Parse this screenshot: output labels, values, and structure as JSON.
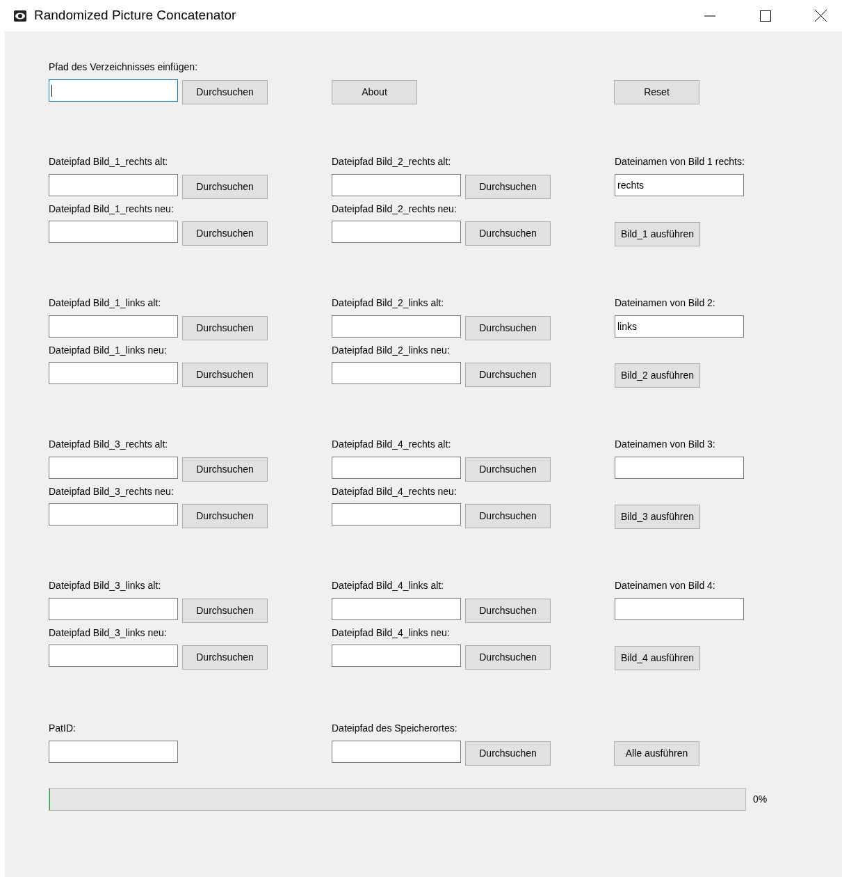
{
  "window": {
    "title": "Randomized Picture Concatenator"
  },
  "directory": {
    "label": "Pfad des Verzeichnisses einfügen:",
    "focused": true,
    "button": "Durchsuchen"
  },
  "about_button": "About",
  "reset_button": "Reset",
  "groups": [
    {
      "columns": [
        [
          {
            "label": "Dateipfad Bild_1_rechts alt:",
            "button": "Durchsuchen"
          },
          {
            "label": "Dateipfad Bild_1_rechts neu:",
            "button": "Durchsuchen"
          }
        ],
        [
          {
            "label": "Dateipfad Bild_2_rechts alt:",
            "button": "Durchsuchen"
          },
          {
            "label": "Dateipfad Bild_2_rechts neu:",
            "button": "Durchsuchen"
          }
        ]
      ],
      "name_label": "Dateinamen von Bild 1 rechts:",
      "name_value": "rechts",
      "run_button": "Bild_1 ausführen"
    },
    {
      "columns": [
        [
          {
            "label": "Dateipfad Bild_1_links alt:",
            "button": "Durchsuchen"
          },
          {
            "label": "Dateipfad Bild_1_links neu:",
            "button": "Durchsuchen"
          }
        ],
        [
          {
            "label": "Dateipfad Bild_2_links alt:",
            "button": "Durchsuchen"
          },
          {
            "label": "Dateipfad Bild_2_links neu:",
            "button": "Durchsuchen"
          }
        ]
      ],
      "name_label": "Dateinamen von Bild 2:",
      "name_value": "links",
      "run_button": "Bild_2 ausführen"
    },
    {
      "columns": [
        [
          {
            "label": "Dateipfad Bild_3_rechts alt:",
            "button": "Durchsuchen"
          },
          {
            "label": "Dateipfad Bild_3_rechts neu:",
            "button": "Durchsuchen"
          }
        ],
        [
          {
            "label": "Dateipfad Bild_4_rechts alt:",
            "button": "Durchsuchen"
          },
          {
            "label": "Dateipfad Bild_4_rechts neu:",
            "button": "Durchsuchen"
          }
        ]
      ],
      "name_label": "Dateinamen von Bild 3:",
      "run_button": "Bild_3 ausführen"
    },
    {
      "columns": [
        [
          {
            "label": "Dateipfad Bild_3_links alt:",
            "button": "Durchsuchen"
          },
          {
            "label": "Dateipfad Bild_3_links neu:",
            "button": "Durchsuchen"
          }
        ],
        [
          {
            "label": "Dateipfad Bild_4_links alt:",
            "button": "Durchsuchen"
          },
          {
            "label": "Dateipfad Bild_4_links neu:",
            "button": "Durchsuchen"
          }
        ]
      ],
      "name_label": "Dateinamen von Bild 4:",
      "run_button": "Bild_4 ausführen"
    }
  ],
  "bottom": {
    "patid_label": "PatID:",
    "save_label": "Dateipfad des Speicherortes:",
    "save_button": "Durchsuchen",
    "run_all_button": "Alle ausführen"
  },
  "progress": {
    "level": 0,
    "reading": "0%"
  }
}
